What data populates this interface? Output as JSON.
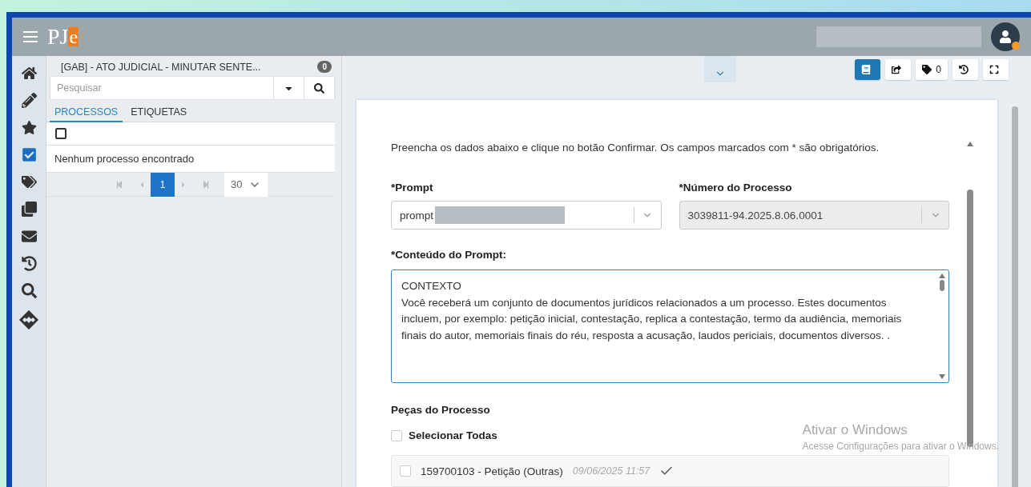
{
  "header": {
    "logo_main": "PJ",
    "logo_accent": "e"
  },
  "task_panel": {
    "title": "[GAB] - ATO JUDICIAL - MINUTAR SENTE...",
    "count": "0",
    "search": {
      "placeholder": "Pesquisar"
    },
    "tabs": [
      {
        "label": "PROCESSOS",
        "selected": true
      },
      {
        "label": "ETIQUETAS",
        "selected": false
      }
    ],
    "select_all": {
      "checked": false
    },
    "empty_message": "Nenhum processo encontrado",
    "pagination": {
      "pages": [
        {
          "label": "1",
          "selected": true
        }
      ],
      "page_size": "30"
    }
  },
  "toolbar": {
    "buttons": [
      {
        "kind": "document",
        "selected": true
      },
      {
        "kind": "share",
        "selected": false
      },
      {
        "kind": "tags",
        "count": "0",
        "selected": false
      },
      {
        "kind": "history",
        "selected": false
      },
      {
        "kind": "fullscreen",
        "selected": false
      }
    ]
  },
  "form": {
    "instructions": "Preencha os dados abaixo e clique no botão Confirmar. Os campos marcados com * são obrigatórios.",
    "prompt": {
      "label": "*Prompt",
      "value": "prompt"
    },
    "process_number": {
      "label": "*Número do Processo",
      "value": "3039811-94.2025.8.06.0001",
      "disabled": true
    },
    "prompt_content": {
      "label": "*Conteúdo do Prompt:",
      "value": "CONTEXTO\nVocê receberá um conjunto de documentos jurídicos relacionados a um processo. Estes documentos incluem, por exemplo: petição inicial, contestação, replica a contestação, termo da audiência, memoriais finais do autor, memoriais finais do réu, resposta a acusação, laudos periciais, documentos diversos. ."
    },
    "pieces": {
      "title": "Peças do Processo",
      "select_all": {
        "label": "Selecionar Todas",
        "checked": false
      },
      "items": [
        {
          "title": "159700103 - Petição (Outras)",
          "date": "09/06/2025 11:57",
          "checked": false
        }
      ]
    }
  },
  "watermark": {
    "title": "Ativar o Windows",
    "subtitle": "Acesse Configurações para ativar o Windows."
  }
}
